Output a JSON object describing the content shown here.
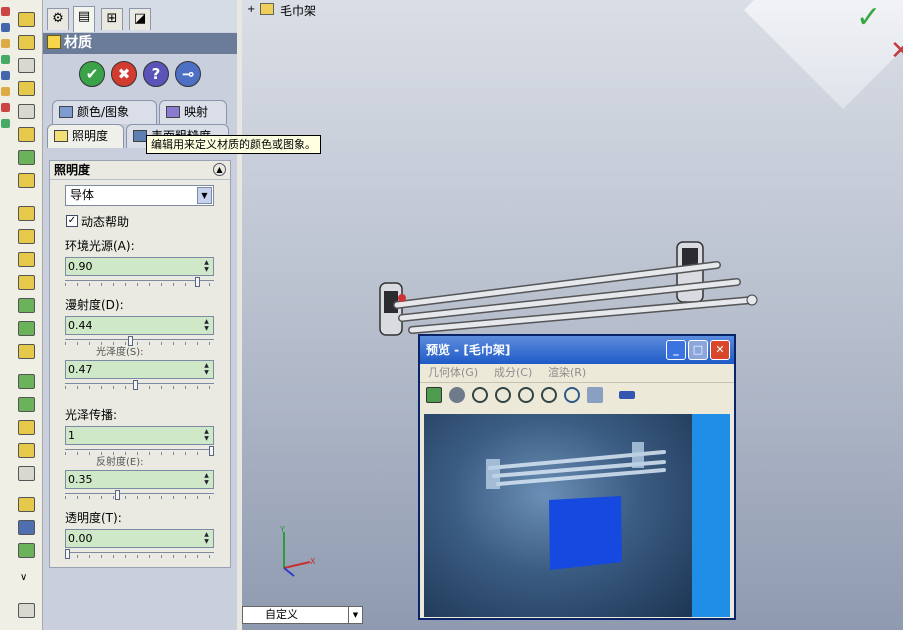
{
  "feature_tree": {
    "part_name": "毛巾架"
  },
  "property_manager": {
    "title": "材质",
    "buttons": {
      "ok": "✔",
      "cancel": "✖",
      "help": "?",
      "pin": "⊸"
    },
    "subtabs": [
      {
        "label": "颜色/图象",
        "icon": "color-image-icon"
      },
      {
        "label": "映射",
        "icon": "mapping-icon"
      },
      {
        "label": "照明度",
        "icon": "lighting-icon"
      },
      {
        "label": "表面粗糙度",
        "icon": "surface-roughness-icon"
      }
    ],
    "tooltip": "编辑用来定义材质的颜色或图象。",
    "group_title": "照明度",
    "material_select": "导体",
    "dynamic_help": {
      "label": "动态帮助",
      "checked": true
    },
    "fields": [
      {
        "label": "环境光源(A):",
        "value": "0.90",
        "level": 0.9
      },
      {
        "label": "漫射度(D):",
        "value": "0.44",
        "level": 0.44
      },
      {
        "label": "光泽度(S):",
        "value": "0.47",
        "level": 0.47
      },
      {
        "label": "光泽传播:",
        "value": "1",
        "level": 1.0
      },
      {
        "label": "反射度(E):",
        "value": "0.35",
        "level": 0.35
      },
      {
        "label": "透明度(T):",
        "value": "0.00",
        "level": 0.0
      }
    ]
  },
  "preview_dialog": {
    "title": "预览 -  [毛巾架]",
    "menu": [
      "几何体(G)",
      "成分(C)",
      "渲染(R)"
    ],
    "tools": [
      "image-icon",
      "gl-icon",
      "zoom-fit-icon",
      "zoom-in-icon",
      "zoom-area-icon",
      "zoom-out-icon",
      "rotate-icon",
      "light-icon",
      "pin-icon"
    ]
  },
  "configuration": {
    "value": "自定义"
  },
  "colors": {
    "accent": "#1f5bc7",
    "ok": "#35a844",
    "cancel": "#d23b2f",
    "field_bg": "#cfe8c8"
  }
}
